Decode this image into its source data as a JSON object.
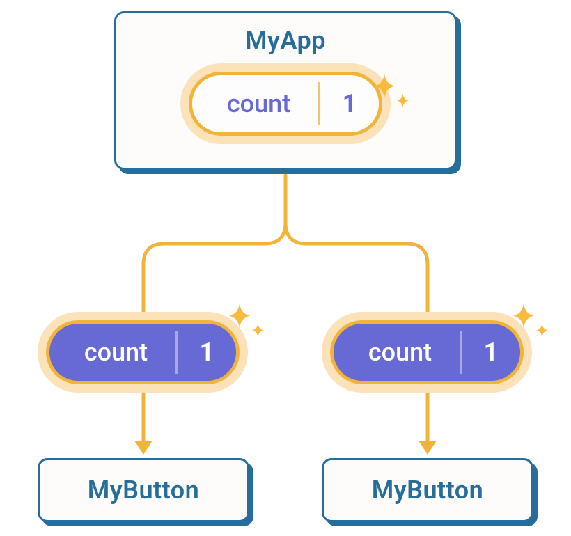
{
  "colors": {
    "card_border": "#266e99",
    "card_bg": "#fefcfb",
    "title": "#266e99",
    "pill_stroke": "#f1b43a",
    "pill_glow": "#fbe2b8",
    "pill_parent_text": "#6769d5",
    "pill_child_bg": "#6769d5",
    "pill_child_text": "#ffffff",
    "wire": "#f1b43a",
    "sparkle": "#f8ba3f"
  },
  "parent": {
    "title": "MyApp",
    "state": {
      "label": "count",
      "value": "1"
    }
  },
  "props": {
    "left": {
      "label": "count",
      "value": "1"
    },
    "right": {
      "label": "count",
      "value": "1"
    }
  },
  "children": {
    "left": {
      "title": "MyButton"
    },
    "right": {
      "title": "MyButton"
    }
  }
}
